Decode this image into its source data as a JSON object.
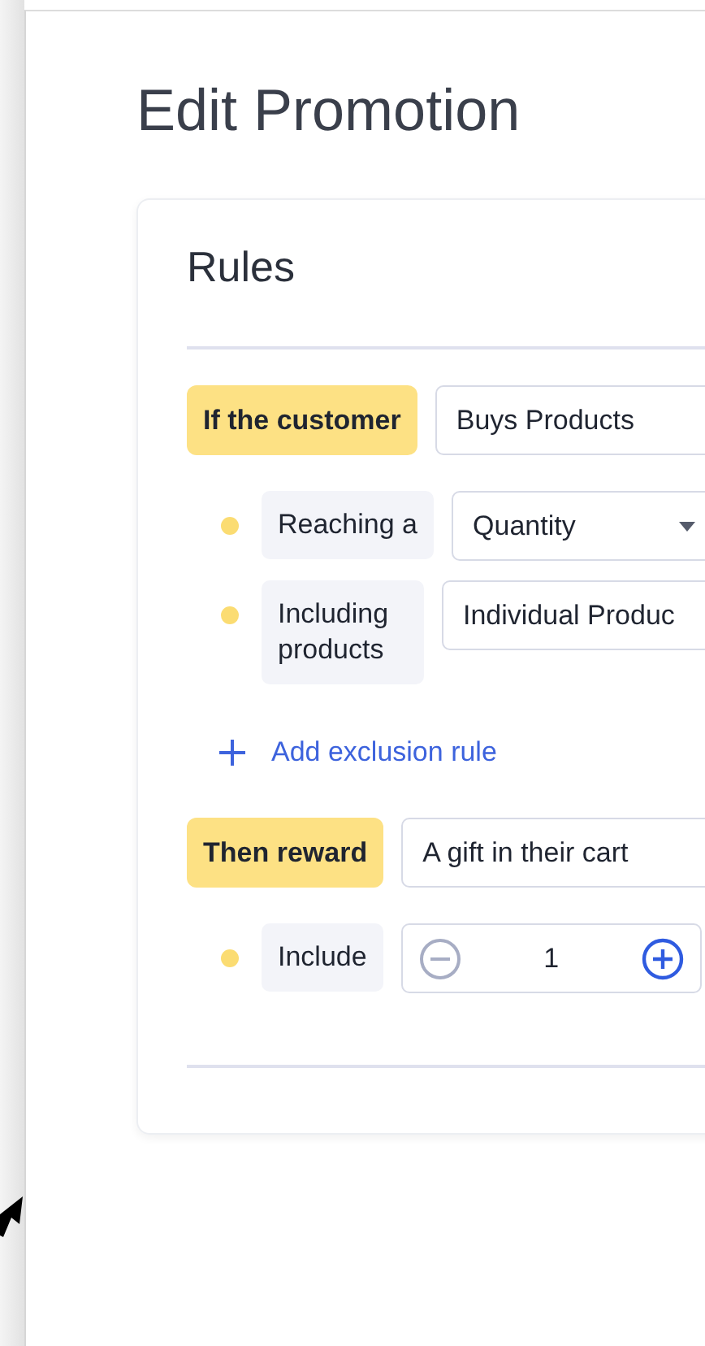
{
  "page": {
    "title": "Edit Promotion"
  },
  "rules": {
    "title": "Rules",
    "sections": [
      {
        "label": "If the customer",
        "value": "Buys Products",
        "conditions": [
          {
            "label": "Reaching a",
            "kind": "dropdown",
            "value": "Quantity"
          },
          {
            "label": "Including products",
            "kind": "field",
            "value": "Individual Produc"
          }
        ],
        "link": "Add exclusion rule"
      },
      {
        "label": "Then reward",
        "value": "A gift in their cart",
        "conditions": [
          {
            "label": "Include",
            "kind": "stepper",
            "value": "1"
          }
        ]
      }
    ]
  }
}
